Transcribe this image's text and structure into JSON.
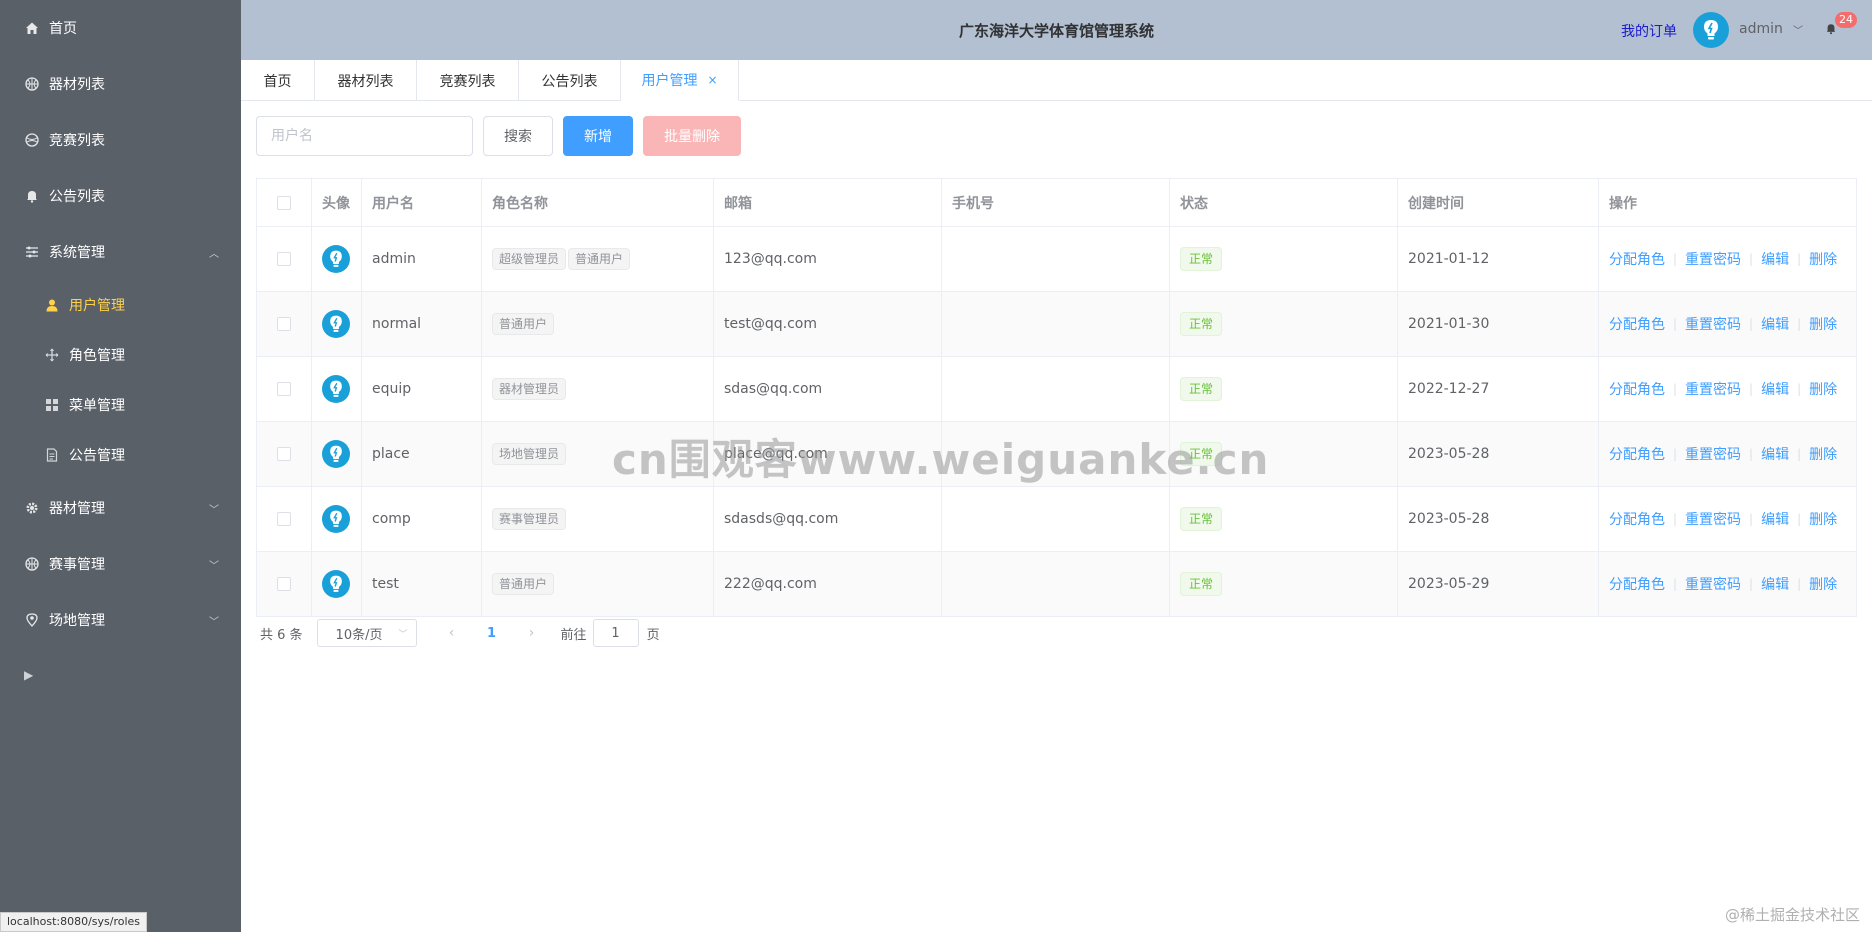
{
  "sidebar": {
    "items": [
      {
        "label": "首页",
        "icon": "home-icon"
      },
      {
        "label": "器材列表",
        "icon": "basketball-icon"
      },
      {
        "label": "竞赛列表",
        "icon": "ball-icon"
      },
      {
        "label": "公告列表",
        "icon": "bell-icon"
      },
      {
        "label": "系统管理",
        "icon": "settings-sliders-icon",
        "expanded": true
      },
      {
        "label": "器材管理",
        "icon": "gear-icon"
      },
      {
        "label": "赛事管理",
        "icon": "basketball-icon"
      },
      {
        "label": "场地管理",
        "icon": "location-icon"
      }
    ],
    "sub_items": [
      {
        "label": "用户管理",
        "icon": "user-icon",
        "active": true
      },
      {
        "label": "角色管理",
        "icon": "rank-icon"
      },
      {
        "label": "菜单管理",
        "icon": "menu-grid-icon"
      },
      {
        "label": "公告管理",
        "icon": "document-icon"
      }
    ]
  },
  "header": {
    "title": "广东海洋大学体育馆管理系统",
    "my_orders": "我的订单",
    "username": "admin",
    "badge_count": "24"
  },
  "tabs": [
    {
      "label": "首页"
    },
    {
      "label": "器材列表"
    },
    {
      "label": "竞赛列表"
    },
    {
      "label": "公告列表"
    },
    {
      "label": "用户管理",
      "active": true,
      "close": "×"
    }
  ],
  "toolbar": {
    "search_placeholder": "用户名",
    "search_label": "搜索",
    "add_label": "新增",
    "batch_delete_label": "批量删除"
  },
  "table": {
    "headers": [
      "头像",
      "用户名",
      "角色名称",
      "邮箱",
      "手机号",
      "状态",
      "创建时间",
      "操作"
    ],
    "rows": [
      {
        "username": "admin",
        "roles": [
          "超级管理员",
          "普通用户"
        ],
        "email": "123@qq.com",
        "phone": "",
        "status": "正常",
        "created": "2021-01-12"
      },
      {
        "username": "normal",
        "roles": [
          "普通用户"
        ],
        "email": "test@qq.com",
        "phone": "",
        "status": "正常",
        "created": "2021-01-30"
      },
      {
        "username": "equip",
        "roles": [
          "器材管理员"
        ],
        "email": "sdas@qq.com",
        "phone": "",
        "status": "正常",
        "created": "2022-12-27"
      },
      {
        "username": "place",
        "roles": [
          "场地管理员"
        ],
        "email": "place@qq.com",
        "phone": "",
        "status": "正常",
        "created": "2023-05-28"
      },
      {
        "username": "comp",
        "roles": [
          "赛事管理员"
        ],
        "email": "sdasds@qq.com",
        "phone": "",
        "status": "正常",
        "created": "2023-05-28"
      },
      {
        "username": "test",
        "roles": [
          "普通用户"
        ],
        "email": "222@qq.com",
        "phone": "",
        "status": "正常",
        "created": "2023-05-29"
      }
    ],
    "ops": [
      "分配角色",
      "重置密码",
      "编辑",
      "删除"
    ]
  },
  "pagination": {
    "total": "共 6 条",
    "page_size": "10条/页",
    "current_page": "1",
    "goto_label": "前往",
    "goto_value": "1",
    "goto_suffix": "页"
  },
  "watermark": "cn围观客www.weiguanke.cn",
  "statusbar_url": "localhost:8080/sys/roles",
  "credit": "@稀土掘金技术社区"
}
